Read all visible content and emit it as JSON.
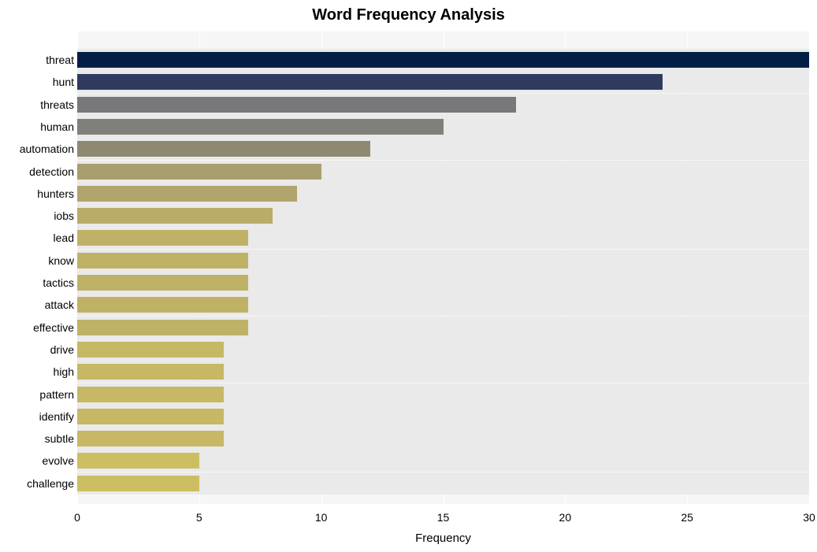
{
  "chart_data": {
    "type": "bar",
    "orientation": "horizontal",
    "title": "Word Frequency Analysis",
    "xlabel": "Frequency",
    "ylabel": "",
    "xlim": [
      0,
      30
    ],
    "x_ticks": [
      0,
      5,
      10,
      15,
      20,
      25,
      30
    ],
    "categories": [
      "threat",
      "hunt",
      "threats",
      "human",
      "automation",
      "detection",
      "hunters",
      "iobs",
      "lead",
      "know",
      "tactics",
      "attack",
      "effective",
      "drive",
      "high",
      "pattern",
      "identify",
      "subtle",
      "evolve",
      "challenge"
    ],
    "values": [
      30,
      24,
      18,
      15,
      12,
      10,
      9,
      8,
      7,
      7,
      7,
      7,
      7,
      6,
      6,
      6,
      6,
      6,
      5,
      5
    ],
    "colors": [
      "#021e44",
      "#303a5f",
      "#78777a",
      "#817f79",
      "#908972",
      "#aa9e6f",
      "#b1a46c",
      "#b9ab6a",
      "#bfb267",
      "#bfb267",
      "#bfb267",
      "#bfb267",
      "#bfb267",
      "#c6b864",
      "#c6b864",
      "#c6b864",
      "#c6b864",
      "#c6b864",
      "#ccbf61",
      "#ccbf61"
    ]
  }
}
